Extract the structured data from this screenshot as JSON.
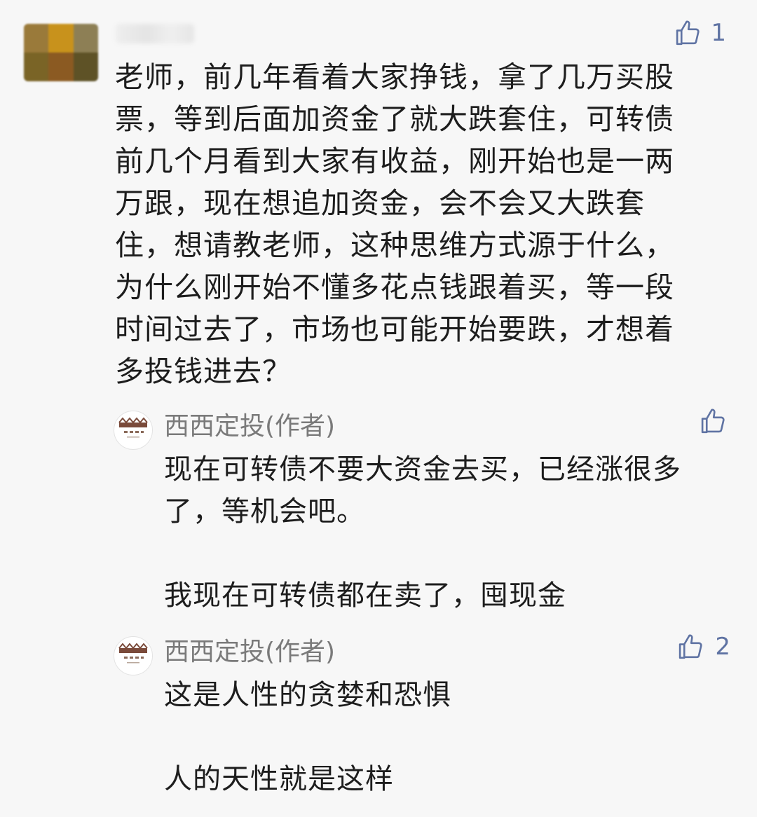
{
  "colors": {
    "background": "#f7f7f7",
    "text": "#1d1d1d",
    "author": "#7a7a7a",
    "like": "#5f73a3"
  },
  "main_comment": {
    "like_icon": "thumbs-up-icon",
    "like_count": "1",
    "lines": [
      "老师，前几年看着大家挣钱，拿了几万买股",
      "票，等到后面加资金了就大跌套住，可转债",
      "前几个月看到大家有收益，刚开始也是一两",
      "万跟，现在想追加资金，会不会又大跌套",
      "住，想请教老师，这种思维方式源于什么，",
      "为什么刚开始不懂多花点钱跟着买，等一段",
      "时间过去了，市场也可能开始要跌，才想着",
      "多投钱进去？"
    ]
  },
  "replies": [
    {
      "author": "西西定投(作者)",
      "like_icon": "thumbs-up-icon",
      "like_count": "",
      "paragraphs": [
        [
          "现在可转债不要大资金去买，已经涨很多",
          "了，等机会吧。"
        ],
        [
          "我现在可转债都在卖了，囤现金"
        ]
      ]
    },
    {
      "author": "西西定投(作者)",
      "like_icon": "thumbs-up-icon",
      "like_count": "2",
      "paragraphs": [
        [
          "这是人性的贪婪和恐惧"
        ],
        [
          "人的天性就是这样"
        ]
      ]
    }
  ]
}
